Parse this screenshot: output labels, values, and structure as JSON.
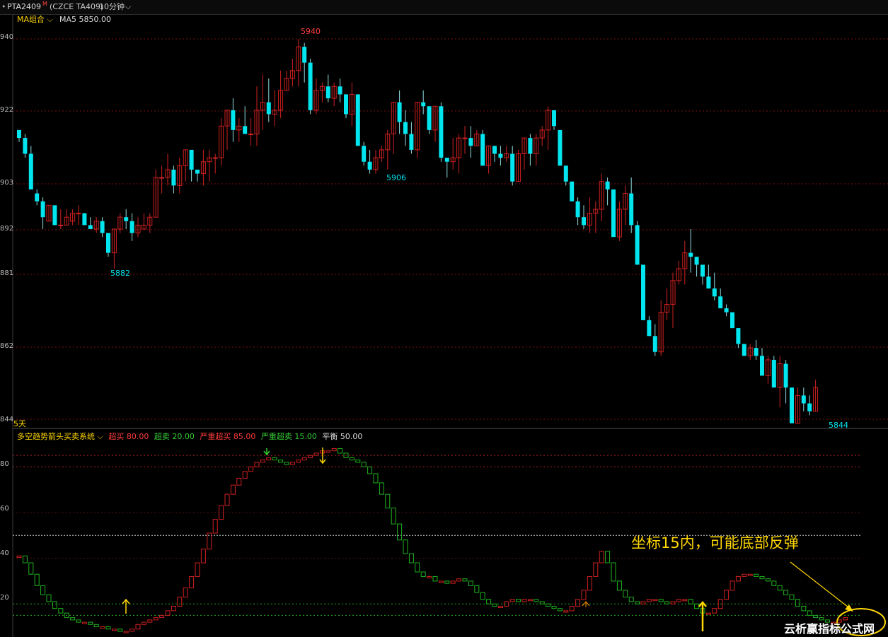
{
  "header": {
    "symbol": "PTA2409",
    "symbol_mark": "M",
    "exchange_code": "(CZCE TA409)",
    "period": "10分钟",
    "ma_menu": "MA组合",
    "ma_readout": "MA5 5850.00"
  },
  "main_panel": {
    "y_labels": [
      "940",
      "922",
      "903",
      "892",
      "881",
      "862",
      "844"
    ],
    "high_label": "5940",
    "low_label_left": "5882",
    "mid_label": "5906",
    "low_label_right": "5844",
    "range_label": "5天"
  },
  "indicator": {
    "name": "多空趋势箭头买卖系统",
    "params": [
      {
        "label": "超买",
        "value": "80.00",
        "color": "#ff3b3b"
      },
      {
        "label": "超卖",
        "value": "20.00",
        "color": "#33cc33"
      },
      {
        "label": "严重超买",
        "value": "85.00",
        "color": "#ff3b3b"
      },
      {
        "label": "严重超卖",
        "value": "15.00",
        "color": "#33cc33"
      },
      {
        "label": "平衡",
        "value": "50.00",
        "color": "#dddddd"
      }
    ],
    "y_labels": [
      "80",
      "60",
      "40",
      "20"
    ]
  },
  "annotation": "坐标15内，可能底部反弹",
  "watermark": "云析赢指标公式网",
  "colors": {
    "up": "#d02020",
    "down": "#00e5ee",
    "osc_up": "#d02020",
    "osc_down": "#1eb31e",
    "arrow": "#ffd700",
    "grid": "#7a1010"
  },
  "chart_data": {
    "type": "candlestick",
    "candles": [
      [
        5917,
        5917,
        5914,
        5915
      ],
      [
        5915,
        5916,
        5910,
        5911
      ],
      [
        5911,
        5913,
        5903,
        5902
      ],
      [
        5901,
        5902,
        5898,
        5899
      ],
      [
        5899,
        5900,
        5892,
        5895
      ],
      [
        5894,
        5898,
        5894,
        5898
      ],
      [
        5898,
        5898,
        5893,
        5893
      ],
      [
        5893,
        5897,
        5892,
        5893
      ],
      [
        5893,
        5897,
        5893,
        5895
      ],
      [
        5894,
        5897,
        5893,
        5896
      ],
      [
        5896,
        5898,
        5893,
        5896
      ],
      [
        5896,
        5896,
        5893,
        5893
      ],
      [
        5893,
        5895,
        5892,
        5892
      ],
      [
        5892,
        5895,
        5891,
        5894
      ],
      [
        5894,
        5895,
        5890,
        5891
      ],
      [
        5891,
        5891,
        5885,
        5886
      ],
      [
        5886,
        5891,
        5882,
        5892
      ],
      [
        5892,
        5896,
        5891,
        5895
      ],
      [
        5895,
        5897,
        5892,
        5894
      ],
      [
        5894,
        5896,
        5889,
        5891
      ],
      [
        5891,
        5895,
        5890,
        5893
      ],
      [
        5892,
        5896,
        5892,
        5893
      ],
      [
        5893,
        5896,
        5891,
        5895
      ],
      [
        5895,
        5907,
        5895,
        5905
      ],
      [
        5905,
        5908,
        5901,
        5905
      ],
      [
        5905,
        5911,
        5903,
        5907
      ],
      [
        5907,
        5908,
        5901,
        5903
      ],
      [
        5903,
        5910,
        5901,
        5908
      ],
      [
        5908,
        5912,
        5904,
        5912
      ],
      [
        5912,
        5911,
        5904,
        5907
      ],
      [
        5907,
        5907,
        5904,
        5906
      ],
      [
        5906,
        5912,
        5903,
        5909
      ],
      [
        5909,
        5912,
        5904,
        5910
      ],
      [
        5910,
        5911,
        5906,
        5910
      ],
      [
        5910,
        5920,
        5908,
        5918
      ],
      [
        5918,
        5922,
        5912,
        5922
      ],
      [
        5922,
        5925,
        5914,
        5917
      ],
      [
        5917,
        5920,
        5914,
        5918
      ],
      [
        5918,
        5923,
        5917,
        5916
      ],
      [
        5916,
        5920,
        5913,
        5916
      ],
      [
        5916,
        5928,
        5913,
        5922
      ],
      [
        5922,
        5931,
        5917,
        5924
      ],
      [
        5924,
        5930,
        5919,
        5921
      ],
      [
        5921,
        5927,
        5918,
        5922
      ],
      [
        5922,
        5932,
        5920,
        5927
      ],
      [
        5927,
        5932,
        5927,
        5930
      ],
      [
        5930,
        5935,
        5928,
        5932
      ],
      [
        5932,
        5940,
        5928,
        5938
      ],
      [
        5938,
        5939,
        5929,
        5934
      ],
      [
        5934,
        5935,
        5921,
        5922
      ],
      [
        5922,
        5930,
        5921,
        5927
      ],
      [
        5927,
        5929,
        5924,
        5928
      ],
      [
        5928,
        5931,
        5924,
        5925
      ],
      [
        5925,
        5929,
        5923,
        5928
      ],
      [
        5928,
        5930,
        5924,
        5926
      ],
      [
        5926,
        5926,
        5920,
        5921
      ],
      [
        5921,
        5929,
        5918,
        5926
      ],
      [
        5926,
        5926,
        5914,
        5913
      ],
      [
        5913,
        5914,
        5908,
        5909
      ],
      [
        5909,
        5912,
        5906,
        5907
      ],
      [
        5907,
        5912,
        5906,
        5910
      ],
      [
        5910,
        5913,
        5909,
        5912
      ],
      [
        5912,
        5917,
        5907,
        5916
      ],
      [
        5916,
        5921,
        5911,
        5924
      ],
      [
        5924,
        5927,
        5916,
        5919
      ],
      [
        5919,
        5922,
        5913,
        5916
      ],
      [
        5916,
        5919,
        5911,
        5912
      ],
      [
        5912,
        5922,
        5910,
        5924
      ],
      [
        5924,
        5927,
        5921,
        5923
      ],
      [
        5923,
        5923,
        5916,
        5917
      ],
      [
        5917,
        5922,
        5914,
        5923
      ],
      [
        5923,
        5924,
        5909,
        5910
      ],
      [
        5910,
        5910,
        5905,
        5909
      ],
      [
        5909,
        5915,
        5907,
        5910
      ],
      [
        5910,
        5916,
        5906,
        5915
      ],
      [
        5915,
        5918,
        5911,
        5915
      ],
      [
        5915,
        5918,
        5910,
        5913
      ],
      [
        5913,
        5917,
        5913,
        5916
      ],
      [
        5916,
        5917,
        5908,
        5908
      ],
      [
        5908,
        5912,
        5906,
        5913
      ],
      [
        5913,
        5913,
        5909,
        5911
      ],
      [
        5911,
        5913,
        5908,
        5910
      ],
      [
        5910,
        5913,
        5909,
        5911
      ],
      [
        5911,
        5913,
        5903,
        5904
      ],
      [
        5904,
        5912,
        5904,
        5911
      ],
      [
        5911,
        5915,
        5907,
        5915
      ],
      [
        5915,
        5916,
        5908,
        5911
      ],
      [
        5911,
        5916,
        5908,
        5915
      ],
      [
        5915,
        5918,
        5913,
        5917
      ],
      [
        5917,
        5923,
        5912,
        5922
      ],
      [
        5922,
        5916,
        5917,
        5918
      ],
      [
        5917,
        5917,
        5910,
        5908
      ],
      [
        5908,
        5905,
        5903,
        5904
      ],
      [
        5904,
        5897,
        5901,
        5899
      ],
      [
        5899,
        5900,
        5893,
        5895
      ],
      [
        5895,
        5898,
        5892,
        5893
      ],
      [
        5893,
        5900,
        5891,
        5896
      ],
      [
        5896,
        5899,
        5891,
        5897
      ],
      [
        5897,
        5906,
        5894,
        5904
      ],
      [
        5904,
        5905,
        5898,
        5902
      ],
      [
        5902,
        5900,
        5892,
        5890
      ],
      [
        5890,
        5899,
        5889,
        5897
      ],
      [
        5897,
        5903,
        5893,
        5901
      ],
      [
        5901,
        5905,
        5891,
        5893
      ],
      [
        5893,
        5894,
        5887,
        5883
      ],
      [
        5883,
        5883,
        5869,
        5869
      ],
      [
        5869,
        5870,
        5866,
        5865
      ],
      [
        5865,
        5868,
        5860,
        5861
      ],
      [
        5861,
        5874,
        5860,
        5871
      ],
      [
        5871,
        5877,
        5869,
        5873
      ],
      [
        5873,
        5881,
        5867,
        5879
      ],
      [
        5879,
        5884,
        5878,
        5882
      ],
      [
        5882,
        5889,
        5878,
        5886
      ],
      [
        5886,
        5892,
        5881,
        5885
      ],
      [
        5885,
        5885,
        5880,
        5883
      ],
      [
        5883,
        5883,
        5878,
        5880
      ],
      [
        5880,
        5883,
        5877,
        5877
      ],
      [
        5877,
        5881,
        5874,
        5875
      ],
      [
        5875,
        5877,
        5872,
        5872
      ],
      [
        5872,
        5873,
        5870,
        5871
      ],
      [
        5871,
        5868,
        5868,
        5867
      ],
      [
        5867,
        5866,
        5862,
        5863
      ],
      [
        5863,
        5863,
        5861,
        5860
      ],
      [
        5860,
        5863,
        5859,
        5862
      ],
      [
        5862,
        5864,
        5859,
        5860
      ],
      [
        5860,
        5862,
        5856,
        5855
      ],
      [
        5855,
        5860,
        5853,
        5859
      ],
      [
        5859,
        5860,
        5852,
        5852
      ],
      [
        5852,
        5860,
        5847,
        5858
      ],
      [
        5858,
        5859,
        5848,
        5852
      ],
      [
        5852,
        5848,
        5844,
        5843
      ],
      [
        5843,
        5852,
        5844,
        5850
      ],
      [
        5850,
        5852,
        5846,
        5848
      ],
      [
        5848,
        5850,
        5845,
        5846
      ],
      [
        5846,
        5854,
        5846,
        5852
      ]
    ],
    "ylim": [
      5844,
      5940
    ],
    "oscillator": [
      41,
      38,
      33,
      28,
      24,
      21,
      18,
      16,
      14,
      13,
      12,
      12,
      11,
      10,
      10,
      9,
      9,
      8,
      8,
      9,
      11,
      12,
      13,
      14,
      15,
      17,
      19,
      23,
      27,
      32,
      38,
      44,
      51,
      57,
      63,
      68,
      72,
      75,
      78,
      80,
      82,
      83,
      84,
      83,
      82,
      81,
      82,
      83,
      84,
      85,
      86,
      87,
      87,
      88,
      86,
      84,
      83,
      82,
      80,
      77,
      73,
      68,
      62,
      55,
      48,
      42,
      38,
      34,
      32,
      32,
      30,
      30,
      29,
      30,
      31,
      30,
      28,
      25,
      22,
      20,
      19,
      19,
      21,
      22,
      21,
      22,
      22,
      21,
      20,
      19,
      18,
      17,
      17,
      19,
      22,
      26,
      32,
      38,
      43,
      38,
      30,
      26,
      23,
      21,
      20,
      21,
      22,
      22,
      21,
      20,
      21,
      22,
      22,
      20,
      18,
      16,
      16,
      18,
      22,
      26,
      30,
      32,
      33,
      33,
      32,
      31,
      30,
      28,
      26,
      24,
      22,
      19,
      17,
      15,
      14,
      13,
      12,
      12,
      13,
      14
    ],
    "osc_ylim": [
      8,
      90
    ],
    "levels": {
      "overbought": 80,
      "oversold": 20,
      "severe_overbought": 85,
      "severe_oversold": 15,
      "balance": 50
    }
  }
}
